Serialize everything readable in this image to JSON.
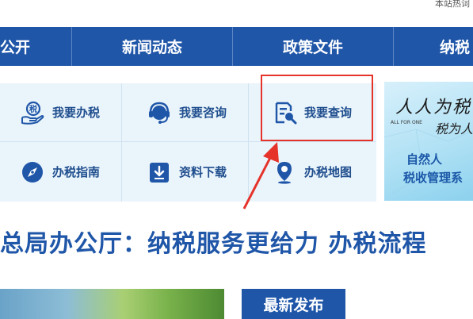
{
  "top_note": "本站热词",
  "nav": {
    "items": [
      {
        "label": "公开"
      },
      {
        "label": "新闻动态"
      },
      {
        "label": "政策文件"
      },
      {
        "label": "纳税"
      }
    ]
  },
  "services": {
    "items": [
      {
        "label": "我要办税",
        "icon": "hand-tax-icon"
      },
      {
        "label": "我要咨询",
        "icon": "headset-icon"
      },
      {
        "label": "我要查询",
        "icon": "document-search-icon"
      },
      {
        "label": "办税指南",
        "icon": "compass-icon"
      },
      {
        "label": "资料下载",
        "icon": "download-icon"
      },
      {
        "label": "办税地图",
        "icon": "map-pin-icon"
      }
    ]
  },
  "annotation": {
    "color": "#e5332a"
  },
  "banner": {
    "calligraphy": "人人为税",
    "sub": "ALL FOR ONE",
    "calligraphy2": "税为人",
    "line1": "自然人",
    "line2": "税收管理系"
  },
  "headline": "总局办公厅：纳税服务更给力 办税流程",
  "news": {
    "tab_label": "最新发布"
  },
  "colors": {
    "primary": "#1f56a8",
    "panel_bg": "#eaf4fb",
    "icon_blue": "#1f56a8"
  }
}
